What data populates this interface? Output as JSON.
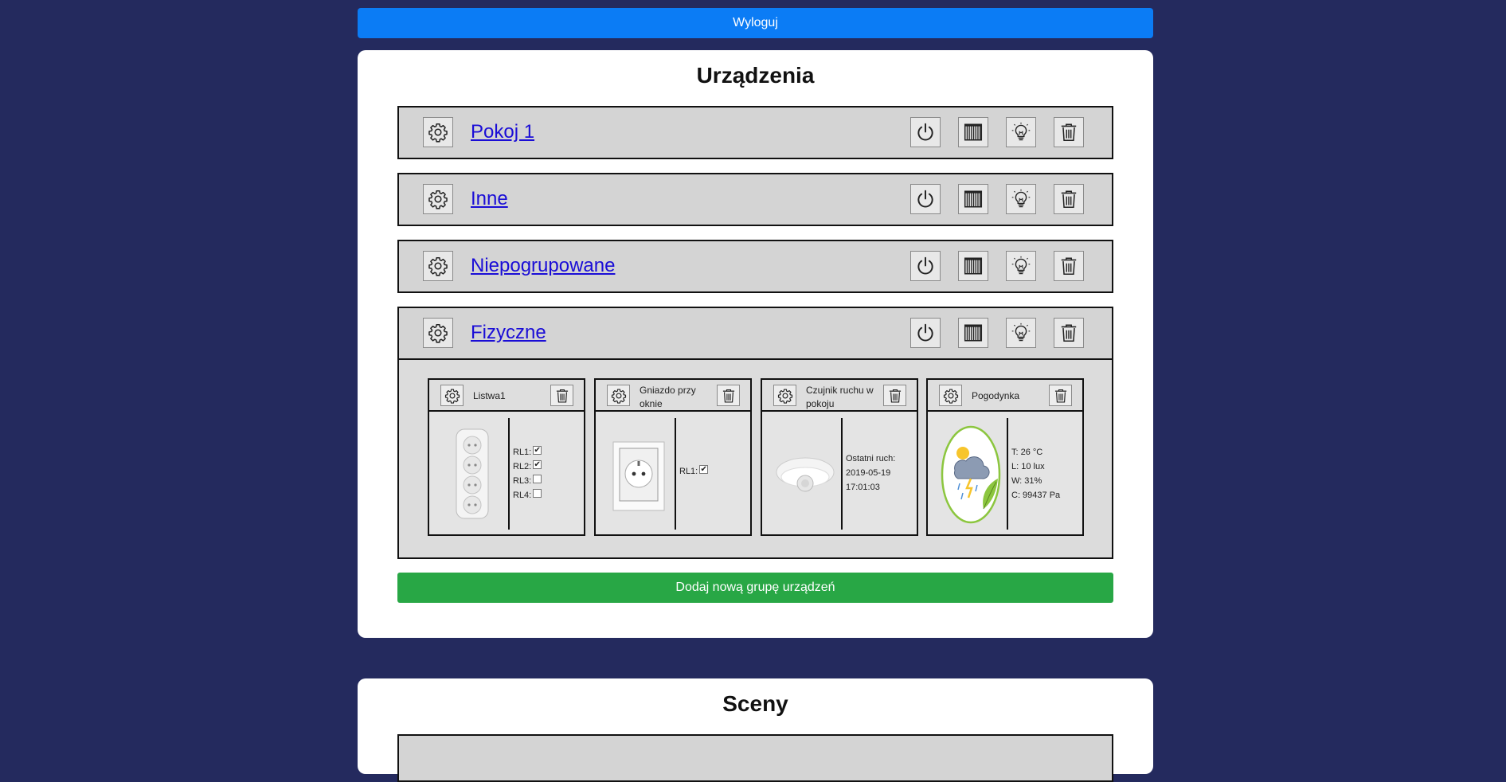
{
  "header": {
    "logout_label": "Wyloguj"
  },
  "devices": {
    "title": "Urządzenia",
    "groups": [
      {
        "name": "Pokoj 1"
      },
      {
        "name": "Inne"
      },
      {
        "name": "Niepogrupowane"
      },
      {
        "name": "Fizyczne"
      }
    ],
    "physical_devices": [
      {
        "name": "Listwa1",
        "relays": [
          "RL1:",
          "RL2:",
          "RL3:",
          "RL4:"
        ],
        "checked": [
          true,
          true,
          false,
          false
        ]
      },
      {
        "name": "Gniazdo przy oknie",
        "relays": [
          "RL1:"
        ],
        "checked": [
          true
        ]
      },
      {
        "name": "Czujnik ruchu w pokoju",
        "info": [
          "Ostatni ruch:",
          "2019-05-19",
          "17:01:03"
        ]
      },
      {
        "name": "Pogodynka",
        "info": [
          "T: 26 °C",
          "L: 10 lux",
          "W: 31%",
          "C: 99437 Pa"
        ]
      }
    ],
    "add_group_label": "Dodaj nową grupę urządzeń"
  },
  "scenes": {
    "title": "Sceny"
  },
  "icons": {
    "settings": "gear-icon",
    "power": "power-icon",
    "blinds": "blinds-icon",
    "light": "lightbulb-icon",
    "delete": "trash-icon"
  },
  "colors": {
    "background": "#242a5e",
    "logout": "#0b7cf5",
    "add": "#28a745",
    "link": "#1a0dd6"
  }
}
